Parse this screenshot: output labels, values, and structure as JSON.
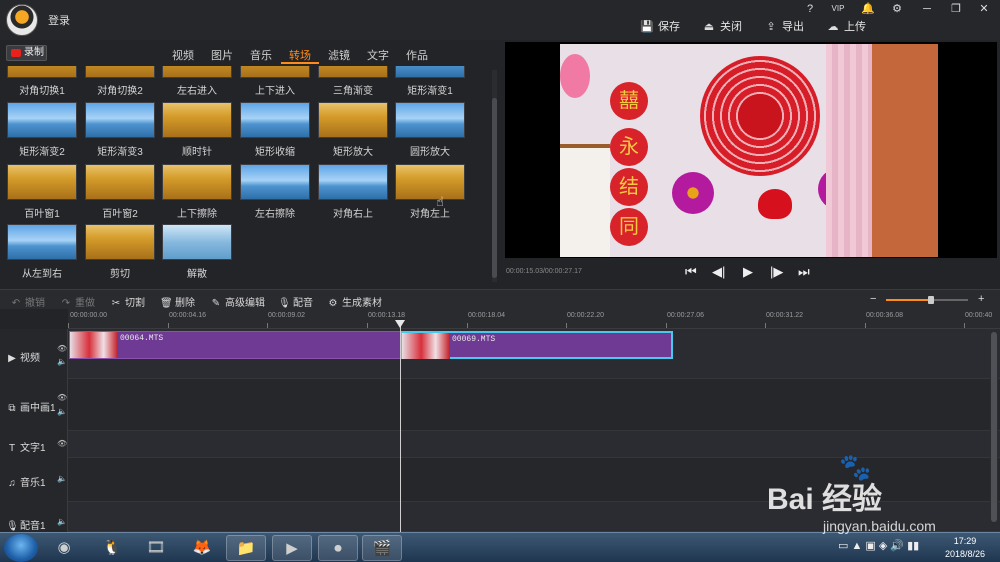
{
  "header": {
    "login": "登录",
    "window_buttons": [
      "?",
      "VIP",
      "🔔",
      "⚙",
      "─",
      "❐",
      "✕"
    ],
    "actions": [
      {
        "icon": "save-icon",
        "glyph": "💾",
        "label": "保存"
      },
      {
        "icon": "close-file-icon",
        "glyph": "⏏",
        "label": "关闭"
      },
      {
        "icon": "export-icon",
        "glyph": "⇪",
        "label": "导出"
      },
      {
        "icon": "upload-icon",
        "glyph": "☁",
        "label": "上传"
      }
    ]
  },
  "library": {
    "record_label": "录制",
    "tabs": [
      "视频",
      "图片",
      "音乐",
      "转场",
      "滤镜",
      "文字",
      "作品"
    ],
    "active_tab": "转场",
    "transitions": [
      "对角切换1",
      "对角切换2",
      "左右进入",
      "上下进入",
      "三角渐变",
      "矩形渐变1",
      "矩形渐变2",
      "矩形渐变3",
      "顺时针",
      "矩形收缩",
      "矩形放大",
      "圆形放大",
      "百叶窗1",
      "百叶窗2",
      "上下擦除",
      "左右擦除",
      "对角右上",
      "对角左上",
      "从左到右",
      "剪切",
      "解散"
    ]
  },
  "preview": {
    "time": "00:00:15.03/00:00:27.17",
    "controls": [
      "⏮",
      "◀|",
      "▶",
      "|▶",
      "⏭"
    ]
  },
  "toolbar": {
    "items": [
      {
        "icon": "undo-icon",
        "glyph": "↶",
        "label": "撤销",
        "enabled": false
      },
      {
        "icon": "redo-icon",
        "glyph": "↷",
        "label": "重做",
        "enabled": false
      },
      {
        "icon": "scissors-icon",
        "glyph": "✂",
        "label": "切割",
        "enabled": true
      },
      {
        "icon": "trash-icon",
        "glyph": "🗑",
        "label": "删除",
        "enabled": true
      },
      {
        "icon": "pencil-icon",
        "glyph": "✎",
        "label": "高级编辑",
        "enabled": true
      },
      {
        "icon": "microphone-icon",
        "glyph": "🎙",
        "label": "配音",
        "enabled": true
      },
      {
        "icon": "generate-icon",
        "glyph": "⚙",
        "label": "生成素材",
        "enabled": true
      }
    ],
    "zoom_minus": "−",
    "zoom_plus": "+",
    "zoom_level": 0.55
  },
  "timeline": {
    "ruler": [
      "00:00:00.00",
      "00:00:04.16",
      "00:00:09.02",
      "00:00:13.18",
      "00:00:18.04",
      "00:00:22.20",
      "00:00:27.06",
      "00:00:31.22",
      "00:00:36.08",
      "00:00:40"
    ],
    "tracks": [
      {
        "name": "视频",
        "icon": "play-icon",
        "glyph": "▶"
      },
      {
        "name": "画中画1",
        "icon": "pip-icon",
        "glyph": "⧉"
      },
      {
        "name": "文字1",
        "icon": "text-icon",
        "glyph": "T"
      },
      {
        "name": "音乐1",
        "icon": "music-icon",
        "glyph": "♫"
      },
      {
        "name": "配音1",
        "icon": "microphone-icon",
        "glyph": "🎙"
      }
    ],
    "clips": [
      {
        "name": "00064.MTS",
        "selected": false
      },
      {
        "name": "00069.MTS",
        "selected": true
      }
    ]
  },
  "taskbar": {
    "apps": [
      {
        "icon": "windows-start-icon",
        "glyph": ""
      },
      {
        "icon": "360-icon",
        "glyph": "◉"
      },
      {
        "icon": "qq-icon",
        "glyph": "🐧"
      },
      {
        "icon": "media-player-icon",
        "glyph": "🎞"
      },
      {
        "icon": "firefox-icon",
        "glyph": "🦊"
      },
      {
        "icon": "folder-icon",
        "glyph": "📁"
      },
      {
        "icon": "video-app-icon",
        "glyph": "▶"
      },
      {
        "icon": "record-app-icon",
        "glyph": "⏺"
      },
      {
        "icon": "editor-app-icon",
        "glyph": "🎬"
      }
    ],
    "tray": "▭ ▲ ▣ ◈ 🔊 ▮▮",
    "time": "17:29",
    "date": "2018/8/26"
  },
  "watermark": {
    "main": "Bai  经验",
    "sub": "jingyan.baidu.com"
  }
}
